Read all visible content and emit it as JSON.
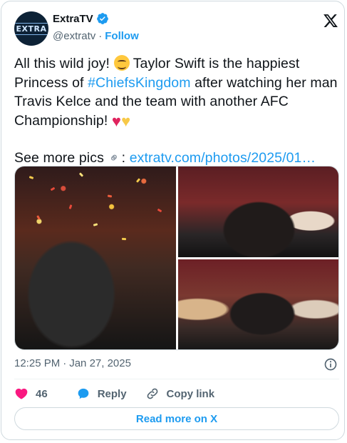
{
  "author": {
    "avatar_text": "EXTRA",
    "display_name": "ExtraTV",
    "handle": "@extratv",
    "separator": "·",
    "follow_label": "Follow"
  },
  "tweet": {
    "line1_a": "All this wild joy! ",
    "line1_b": " Taylor Swift is the happiest",
    "line2_a": "Princess of ",
    "hashtag": "#ChiefsKingdom",
    "line2_b": " after watching her man",
    "line3": "Travis Kelce and the team with another AFC",
    "line4": "Championship! ",
    "see_more": "See more pics ",
    "colon": ": ",
    "link": "extratv.com/photos/2025/01…"
  },
  "media": {
    "count": 3
  },
  "meta": {
    "time": "12:25 PM",
    "separator": "·",
    "date": "Jan 27, 2025"
  },
  "actions": {
    "like_count": "46",
    "reply_label": "Reply",
    "copy_label": "Copy link"
  },
  "read_more_label": "Read more on X",
  "colors": {
    "accent": "#1d9bf0",
    "like": "#f91880",
    "muted": "#536471",
    "border": "#cfd9de"
  }
}
